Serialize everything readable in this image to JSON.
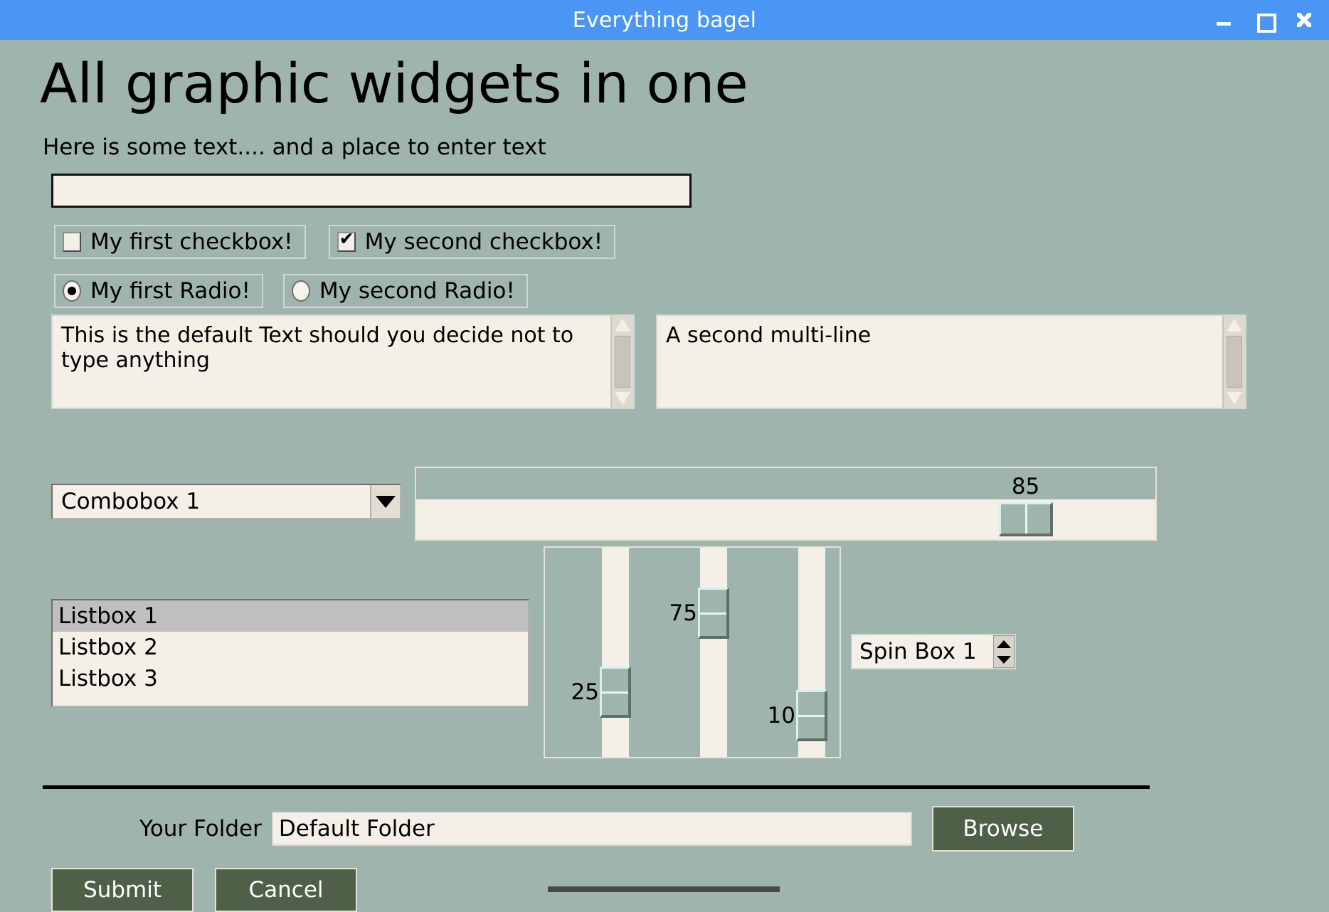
{
  "window": {
    "title": "Everything bagel",
    "controls": [
      {
        "name": "minimize",
        "glyph": "minimize-icon"
      },
      {
        "name": "maximize",
        "glyph": "maximize-icon"
      },
      {
        "name": "close",
        "glyph": "close-icon"
      }
    ]
  },
  "colors": {
    "titlebar": "#4b95f5",
    "background": "#9fb4ad",
    "field": "#f4f0e8",
    "button": "#4e6048",
    "selection": "#bfbfbf"
  },
  "heading": "All graphic widgets in one",
  "subtitle": "Here is some text.... and a place to enter text",
  "text_input": {
    "value": "",
    "placeholder": ""
  },
  "checkboxes": [
    {
      "label": "My first checkbox!",
      "checked": false
    },
    {
      "label": "My second checkbox!",
      "checked": true
    }
  ],
  "radios": [
    {
      "label": "My first Radio!",
      "selected": true
    },
    {
      "label": "My second Radio!",
      "selected": false
    }
  ],
  "multiline": [
    {
      "value": "This is the default Text should you decide not to type anything"
    },
    {
      "value": "A second multi-line"
    }
  ],
  "combobox": {
    "value": "Combobox 1"
  },
  "h_slider": {
    "value": "85",
    "min": 0,
    "max": 100
  },
  "listbox": {
    "items": [
      "Listbox 1",
      "Listbox 2",
      "Listbox 3"
    ],
    "selected_index": 0
  },
  "v_sliders": [
    {
      "value": "25",
      "min": 0,
      "max": 100
    },
    {
      "value": "75",
      "min": 0,
      "max": 100
    },
    {
      "value": "10",
      "min": 0,
      "max": 100
    }
  ],
  "spinbox": {
    "value": "Spin Box 1"
  },
  "folder": {
    "label": "Your Folder",
    "value": "Default Folder",
    "browse_label": "Browse"
  },
  "actions": [
    {
      "label": "Submit"
    },
    {
      "label": "Cancel"
    }
  ]
}
